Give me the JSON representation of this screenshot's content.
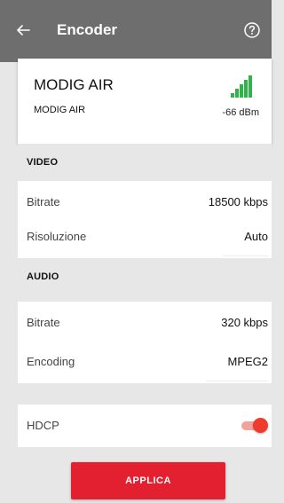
{
  "colors": {
    "appbar": "#6e6e6e",
    "background": "#e7e7e7",
    "accent": "#e3202f",
    "signal": "#2fb34a",
    "toggle_on": "#ee3b2d"
  },
  "appbar": {
    "title": "Encoder",
    "back_icon": "arrow-left-icon",
    "help_icon": "help-circle-icon"
  },
  "device": {
    "name": "MODIG AIR",
    "subtitle": "MODIG AIR",
    "signal_icon": "signal-strength-icon",
    "signal_value": "-66 dBm"
  },
  "video": {
    "header": "VIDEO",
    "bitrate_label": "Bitrate",
    "bitrate_value": "18500 kbps",
    "resolution_label": "Risoluzione",
    "resolution_value": "Auto"
  },
  "audio": {
    "header": "AUDIO",
    "bitrate_label": "Bitrate",
    "bitrate_value": "320 kbps",
    "encoding_label": "Encoding",
    "encoding_value": "MPEG2"
  },
  "hdcp": {
    "label": "HDCP",
    "enabled": true
  },
  "apply_label": "APPLICA"
}
